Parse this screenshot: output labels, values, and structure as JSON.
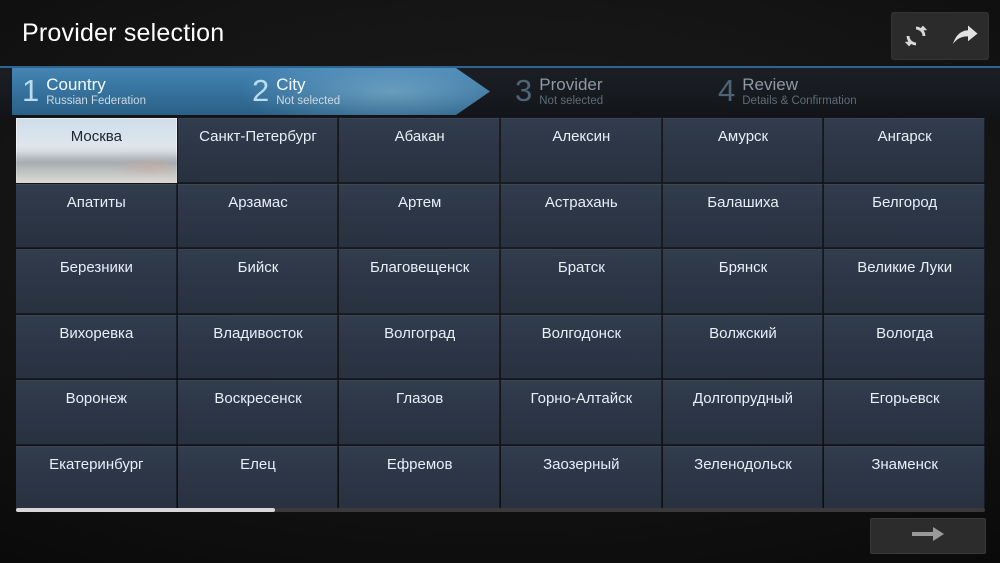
{
  "header": {
    "title": "Provider selection",
    "toolbar": [
      {
        "name": "refresh-icon",
        "icon": "refresh"
      },
      {
        "name": "forward-icon",
        "icon": "forward-arrow"
      }
    ]
  },
  "steps": [
    {
      "num": "1",
      "label": "Country",
      "sub": "Russian Federation",
      "state": "on"
    },
    {
      "num": "2",
      "label": "City",
      "sub": "Not selected",
      "state": "on"
    },
    {
      "num": "3",
      "label": "Provider",
      "sub": "Not selected",
      "state": "off"
    },
    {
      "num": "4",
      "label": "Review",
      "sub": "Details & Confirmation",
      "state": "off"
    }
  ],
  "grid": {
    "columns": 6,
    "cities": [
      {
        "name": "Москва",
        "selected": true
      },
      {
        "name": "Санкт-Петербург",
        "selected": false
      },
      {
        "name": "Абакан",
        "selected": false
      },
      {
        "name": "Алексин",
        "selected": false
      },
      {
        "name": "Амурск",
        "selected": false
      },
      {
        "name": "Ангарск",
        "selected": false
      },
      {
        "name": "Апатиты",
        "selected": false
      },
      {
        "name": "Арзамас",
        "selected": false
      },
      {
        "name": "Артем",
        "selected": false
      },
      {
        "name": "Астрахань",
        "selected": false
      },
      {
        "name": "Балашиха",
        "selected": false
      },
      {
        "name": "Белгород",
        "selected": false
      },
      {
        "name": "Березники",
        "selected": false
      },
      {
        "name": "Бийск",
        "selected": false
      },
      {
        "name": "Благовещенск",
        "selected": false
      },
      {
        "name": "Братск",
        "selected": false
      },
      {
        "name": "Брянск",
        "selected": false
      },
      {
        "name": "Великие Луки",
        "selected": false
      },
      {
        "name": "Вихоревка",
        "selected": false
      },
      {
        "name": "Владивосток",
        "selected": false
      },
      {
        "name": "Волгоград",
        "selected": false
      },
      {
        "name": "Волгодонск",
        "selected": false
      },
      {
        "name": "Волжский",
        "selected": false
      },
      {
        "name": "Вологда",
        "selected": false
      },
      {
        "name": "Воронеж",
        "selected": false
      },
      {
        "name": "Воскресенск",
        "selected": false
      },
      {
        "name": "Глазов",
        "selected": false
      },
      {
        "name": "Горно-Алтайск",
        "selected": false
      },
      {
        "name": "Долгопрудный",
        "selected": false
      },
      {
        "name": "Егорьевск",
        "selected": false
      },
      {
        "name": "Екатеринбург",
        "selected": false
      },
      {
        "name": "Елец",
        "selected": false
      },
      {
        "name": "Ефремов",
        "selected": false
      },
      {
        "name": "Заозерный",
        "selected": false
      },
      {
        "name": "Зеленодольск",
        "selected": false
      },
      {
        "name": "Знаменск",
        "selected": false
      }
    ]
  },
  "scrollbar": {
    "orientation": "horizontal",
    "thumb_fraction": 0.2675
  },
  "footer": {
    "next_button": {
      "name": "next-button",
      "icon": "right-arrow"
    }
  },
  "colors": {
    "accent_blue": "#4585b4",
    "step_rule": "#2e6590",
    "cell_bg": "#2c3646",
    "cell_text": "#e6eef6",
    "background": "#141414"
  }
}
